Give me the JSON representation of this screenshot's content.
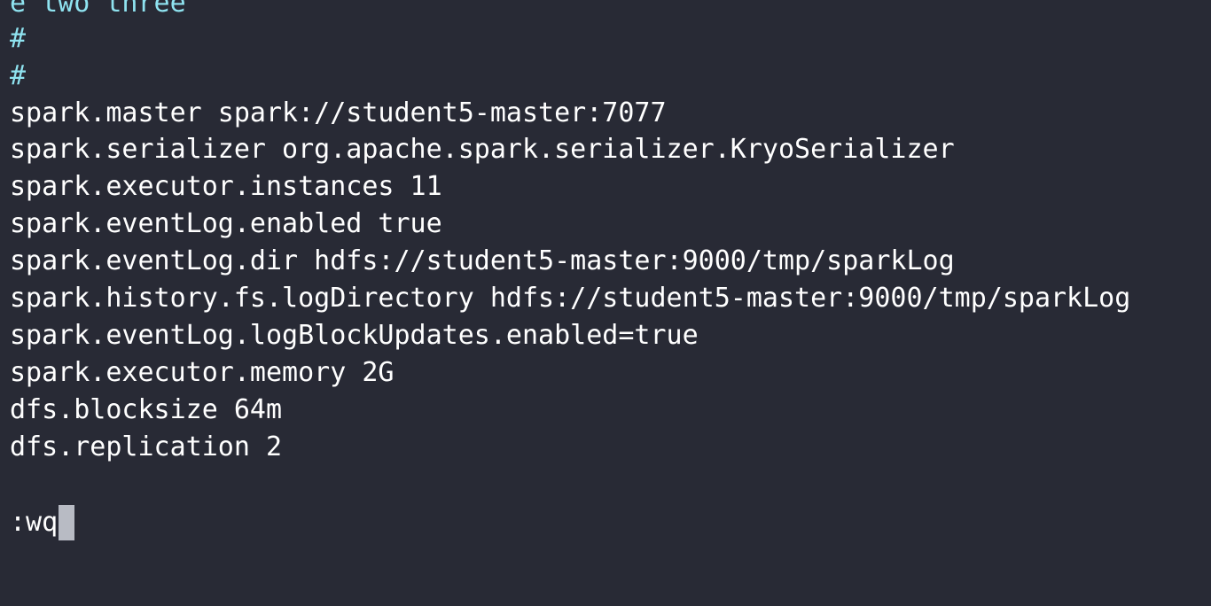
{
  "editor": {
    "lines": [
      "e two three",
      "#",
      "#",
      "spark.master spark://student5-master:7077",
      "spark.serializer org.apache.spark.serializer.KryoSerializer",
      "spark.executor.instances 11",
      "spark.eventLog.enabled true",
      "spark.eventLog.dir hdfs://student5-master:9000/tmp/sparkLog",
      "spark.history.fs.logDirectory hdfs://student5-master:9000/tmp/sparkLog",
      "spark.eventLog.logBlockUpdates.enabled=true",
      "spark.executor.memory 2G",
      "dfs.blocksize 64m",
      "dfs.replication 2"
    ]
  },
  "command_line": {
    "text": ":wq"
  },
  "colors": {
    "background": "#282a35",
    "text": "#ffffff",
    "comment": "#8fe3f0",
    "cursor": "#b8bbc4"
  }
}
